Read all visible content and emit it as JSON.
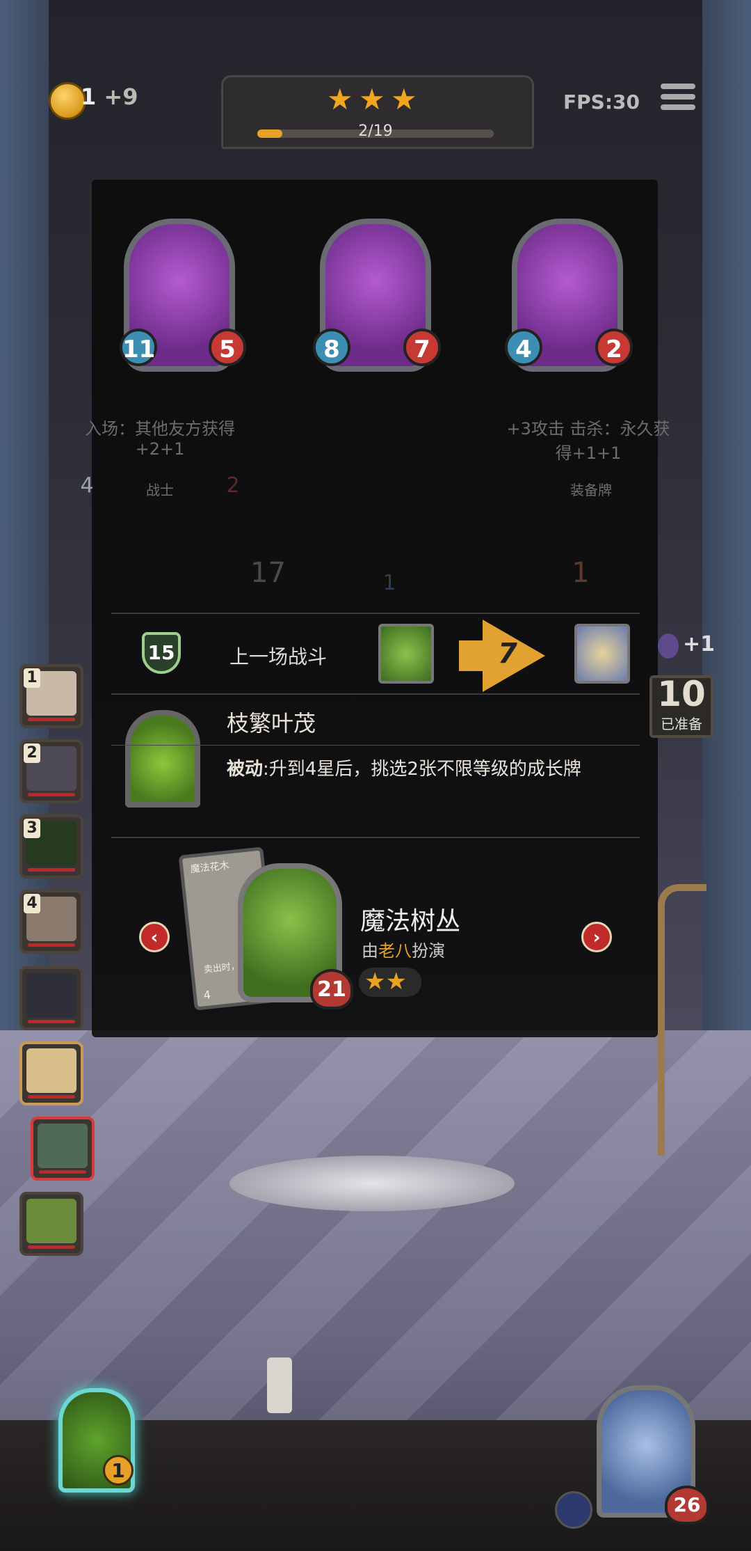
{
  "hud": {
    "coin_label": "1",
    "coin_plus": "+9",
    "stars": [
      "★",
      "★",
      "★"
    ],
    "progress_text": "2/19",
    "progress_value": 2,
    "progress_max": 19,
    "fps_label": "FPS:30"
  },
  "side_slots": [
    {
      "num": "1",
      "color": "#c9b9a6"
    },
    {
      "num": "2",
      "color": "#4d4a55"
    },
    {
      "num": "3",
      "color": "#263a1f"
    },
    {
      "num": "4",
      "color": "#8a7a6e"
    },
    {
      "num": "",
      "color": "#2e2f38"
    },
    {
      "num": "",
      "color": "#d9c08a"
    },
    {
      "num": "",
      "color": "#4f6b56"
    },
    {
      "num": "",
      "color": "#6a8c3a"
    }
  ],
  "lineup": [
    {
      "atk": "11",
      "hp": "5",
      "color": "#c26bd5"
    },
    {
      "atk": "8",
      "hp": "7",
      "color": "#8b4fa3"
    },
    {
      "atk": "4",
      "hp": "2",
      "color": "#8a44b0"
    }
  ],
  "behind_text": {
    "card_left_desc": "入场：其他友方获得+2+1",
    "card_right_desc": "+3攻击 击杀：永久获得+1+1",
    "card_left_tag": "战士",
    "card_right_tag": "装备牌",
    "count_17": "17",
    "count_1a": "1",
    "count_1b": "1",
    "num_4": "4",
    "num_2": "2"
  },
  "battle": {
    "shield_value": "15",
    "label": "上一场战斗",
    "damage": "7"
  },
  "skill": {
    "name": "枝繁叶茂",
    "desc_prefix": "被动",
    "desc_body": ":升到4星后，挑选2张不限等级的成长牌"
  },
  "character": {
    "name": "魔法树丛",
    "sub_prefix": "由",
    "sub_actor": "老八",
    "sub_suffix": "扮演",
    "hp": "21",
    "stars": [
      "★",
      "★"
    ],
    "card_back_title": "魔法花木",
    "card_back_text": "卖出时，2张",
    "card_back_num": "4"
  },
  "right_panel": {
    "plus": "+1",
    "ready_num": "10",
    "ready_label": "已准备"
  },
  "bottom": {
    "left_level": "1",
    "right_hp": "26"
  },
  "colors": {
    "gold": "#e6a126",
    "red": "#c63a33",
    "blue": "#3c8fb2"
  }
}
